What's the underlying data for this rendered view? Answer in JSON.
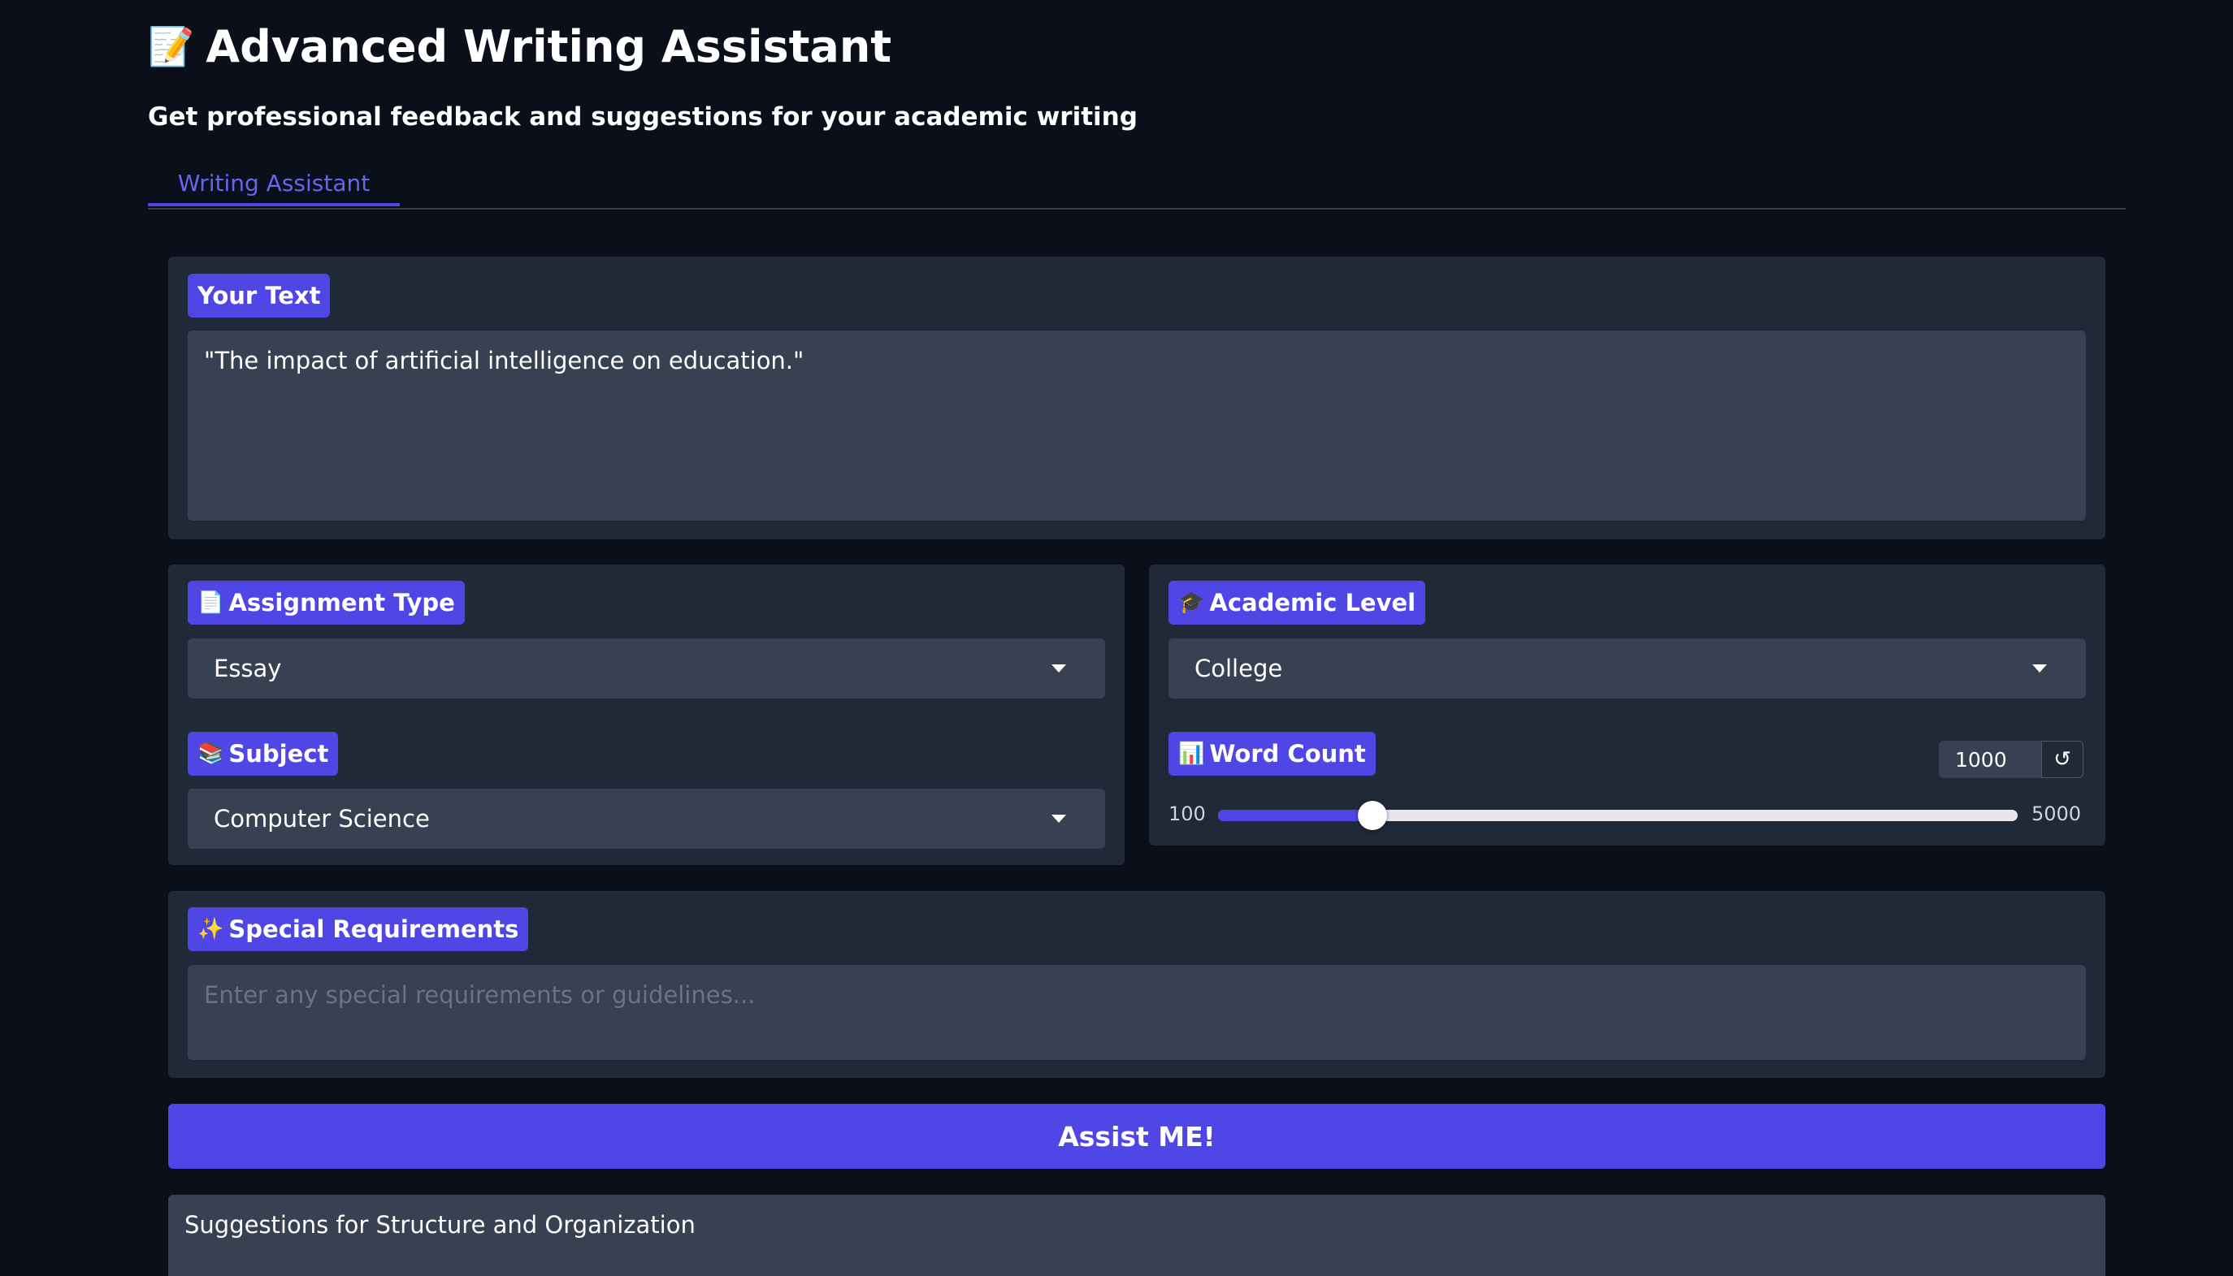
{
  "header": {
    "title": "Advanced Writing Assistant",
    "title_icon": "📝",
    "subtitle": "Get professional feedback and suggestions for your academic writing"
  },
  "tabs": [
    {
      "label": "Writing Assistant",
      "selected": true
    }
  ],
  "your_text": {
    "label": "Your Text",
    "value": "\"The impact of artificial intelligence on education.\""
  },
  "assignment_type": {
    "icon": "📄",
    "label": "Assignment Type",
    "value": "Essay"
  },
  "subject": {
    "icon": "📚",
    "label": "Subject",
    "value": "Computer Science"
  },
  "academic_level": {
    "icon": "🎓",
    "label": "Academic Level",
    "value": "College"
  },
  "word_count": {
    "icon": "📊",
    "label": "Word Count",
    "value": "1000",
    "min": "100",
    "max": "5000",
    "reset_icon": "↺"
  },
  "special_requirements": {
    "icon": "✨",
    "label": "Special Requirements",
    "placeholder": "Enter any special requirements or guidelines..."
  },
  "assist_button": {
    "label": "Assist ME!"
  },
  "output": {
    "label": "Suggestions for Structure and Organization"
  },
  "colors": {
    "background": "#0b0f19",
    "panel": "#1f2937",
    "field": "#374151",
    "accent": "#4f46e5"
  }
}
